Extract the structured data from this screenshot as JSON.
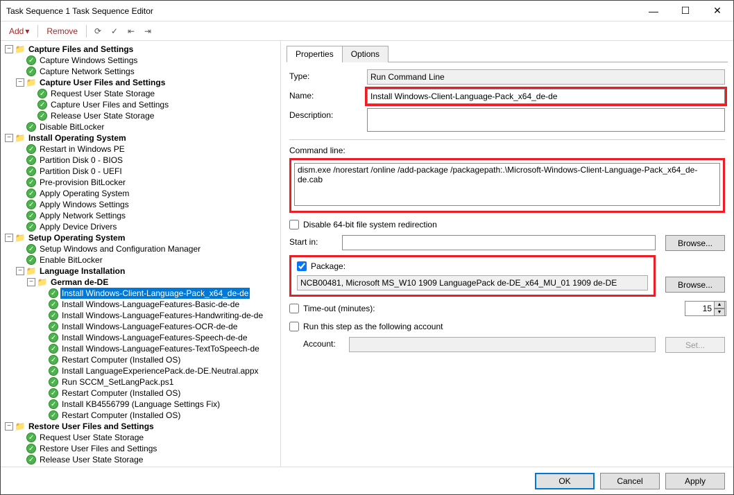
{
  "window": {
    "title": "Task Sequence 1 Task Sequence Editor"
  },
  "toolbar": {
    "add": "Add",
    "remove": "Remove"
  },
  "tree": {
    "g1": {
      "label": "Capture Files and Settings",
      "i1": "Capture Windows Settings",
      "i2": "Capture Network Settings",
      "g1a": {
        "label": "Capture User Files and Settings",
        "i1": "Request User State Storage",
        "i2": "Capture User Files and Settings",
        "i3": "Release User State Storage"
      },
      "i3": "Disable BitLocker"
    },
    "g2": {
      "label": "Install Operating System",
      "i1": "Restart in Windows PE",
      "i2": "Partition Disk 0 - BIOS",
      "i3": "Partition Disk 0 - UEFI",
      "i4": "Pre-provision BitLocker",
      "i5": "Apply Operating System",
      "i6": "Apply Windows Settings",
      "i7": "Apply Network Settings",
      "i8": "Apply Device Drivers"
    },
    "g3": {
      "label": "Setup Operating System",
      "i1": "Setup Windows and Configuration Manager",
      "i2": "Enable BitLocker",
      "g3a": {
        "label": "Language Installation",
        "g3a1": {
          "label": "German de-DE",
          "i1": "Install Windows-Client-Language-Pack_x64_de-de",
          "i2": "Install Windows-LanguageFeatures-Basic-de-de",
          "i3": "Install Windows-LanguageFeatures-Handwriting-de-de",
          "i4": "Install Windows-LanguageFeatures-OCR-de-de",
          "i5": "Install Windows-LanguageFeatures-Speech-de-de",
          "i6": "Install Windows-LanguageFeatures-TextToSpeech-de",
          "i7": "Restart Computer (Installed OS)",
          "i8": "Install LanguageExperiencePack.de-DE.Neutral.appx",
          "i9": "Run SCCM_SetLangPack.ps1",
          "i10": "Restart Computer (Installed OS)",
          "i11": "Install KB4556799 (Language Settings Fix)",
          "i12": "Restart Computer (Installed OS)"
        }
      }
    },
    "g4": {
      "label": "Restore User Files and Settings",
      "i1": "Request User State Storage",
      "i2": "Restore User Files and Settings",
      "i3": "Release User State Storage"
    }
  },
  "tabs": {
    "properties": "Properties",
    "options": "Options"
  },
  "form": {
    "type_label": "Type:",
    "type_value": "Run Command Line",
    "name_label": "Name:",
    "name_value": "Install Windows-Client-Language-Pack_x64_de-de",
    "desc_label": "Description:",
    "desc_value": "",
    "cmdline_label": "Command line:",
    "cmdline_value": "dism.exe /norestart /online /add-package /packagepath:.\\Microsoft-Windows-Client-Language-Pack_x64_de-de.cab",
    "disable64": "Disable 64-bit file system redirection",
    "startin_label": "Start in:",
    "startin_value": "",
    "browse": "Browse...",
    "package_label": "Package:",
    "package_value": "NCB00481, Microsoft MS_W10 1909 LanguagePack de-DE_x64_MU_01 1909 de-DE",
    "timeout_label": "Time-out (minutes):",
    "timeout_value": "15",
    "runas_label": "Run this step as the following account",
    "account_label": "Account:",
    "account_value": "",
    "set_btn": "Set..."
  },
  "footer": {
    "ok": "OK",
    "cancel": "Cancel",
    "apply": "Apply"
  }
}
